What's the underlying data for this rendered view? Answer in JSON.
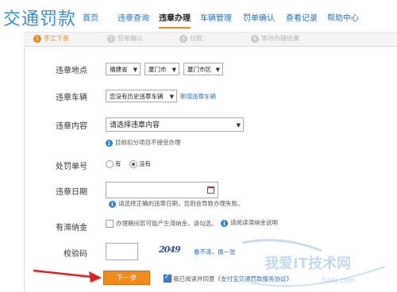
{
  "app": {
    "logo": "交通罚款"
  },
  "nav": {
    "items": [
      {
        "label": "首页"
      },
      {
        "label": "违章查询"
      },
      {
        "label": "违章办理"
      },
      {
        "label": "车辆管理"
      },
      {
        "label": "罚单确认"
      },
      {
        "label": "查看记录"
      },
      {
        "label": "帮助中心"
      }
    ],
    "active": "违章办理"
  },
  "steps": [
    {
      "num": "1",
      "label": "手工下单"
    },
    {
      "num": "2",
      "label": "罚单确认"
    },
    {
      "num": "3",
      "label": "付款"
    },
    {
      "num": "4",
      "label": "等待办理结果"
    }
  ],
  "form": {
    "location": {
      "label": "违章地点",
      "province": "福建省",
      "city": "厦门市",
      "district": "厦门市区"
    },
    "vehicle": {
      "label": "违章车辆",
      "select": "您没有历史违章车辆",
      "add_link": "新增违章车辆"
    },
    "content": {
      "label": "违章内容",
      "select": "请选择违章内容",
      "hint": "目前扣分项目不接受办理"
    },
    "ticket": {
      "label": "处罚单号",
      "options": [
        "有",
        "没有"
      ],
      "selected": "没有"
    },
    "date": {
      "label": "违章日期",
      "hint": "请选择正确的违章日期，否则会导致办理失败。"
    },
    "late_fee": {
      "label": "有滞纳金",
      "text": "办理期间若可能产生滞纳金，请勾选。",
      "link": "请阅读滞纳金说明"
    },
    "captcha": {
      "label": "校验码",
      "image_text": "2049",
      "refresh": "看不清，换一张"
    },
    "submit": {
      "button": "下一步",
      "agree_prefix": "我已阅读并同意",
      "agreement": "《支付宝交通罚款服务协议》"
    }
  },
  "watermark": {
    "text": "我爱IT技术网",
    "domain": "52itj.com"
  },
  "colors": {
    "brand_blue": "#3a8fd0",
    "accent_orange": "#f08a1a",
    "link_blue": "#2a6fb8",
    "arrow_red": "#e02020"
  }
}
